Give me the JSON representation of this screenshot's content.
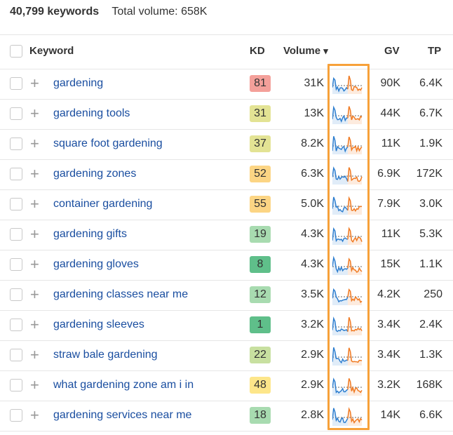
{
  "summary": {
    "count": "40,799 keywords",
    "total_volume": "Total volume: 658K"
  },
  "columns": {
    "keyword": "Keyword",
    "kd": "KD",
    "volume": "Volume",
    "sort_icon": "▾",
    "gv": "GV",
    "tp": "TP"
  },
  "rows": [
    {
      "keyword": "gardening",
      "kd": "81",
      "kd_color": "#f4a09a",
      "volume": "31K",
      "gv": "90K",
      "tp": "6.4K"
    },
    {
      "keyword": "gardening tools",
      "kd": "31",
      "kd_color": "#e3e394",
      "volume": "13K",
      "gv": "44K",
      "tp": "6.7K"
    },
    {
      "keyword": "square foot gardening",
      "kd": "37",
      "kd_color": "#e3e394",
      "volume": "8.2K",
      "gv": "11K",
      "tp": "1.9K"
    },
    {
      "keyword": "gardening zones",
      "kd": "52",
      "kd_color": "#fcd584",
      "volume": "6.3K",
      "gv": "6.9K",
      "tp": "172K"
    },
    {
      "keyword": "container gardening",
      "kd": "55",
      "kd_color": "#fcd584",
      "volume": "5.0K",
      "gv": "7.9K",
      "tp": "3.0K"
    },
    {
      "keyword": "gardening gifts",
      "kd": "19",
      "kd_color": "#a8dbb0",
      "volume": "4.3K",
      "gv": "11K",
      "tp": "5.3K"
    },
    {
      "keyword": "gardening gloves",
      "kd": "8",
      "kd_color": "#5fbf8a",
      "volume": "4.3K",
      "gv": "15K",
      "tp": "1.1K"
    },
    {
      "keyword": "gardening classes near me",
      "kd": "12",
      "kd_color": "#a8dbb0",
      "volume": "3.5K",
      "gv": "4.2K",
      "tp": "250"
    },
    {
      "keyword": "gardening sleeves",
      "kd": "1",
      "kd_color": "#5fbf8a",
      "volume": "3.2K",
      "gv": "3.4K",
      "tp": "2.4K"
    },
    {
      "keyword": "straw bale gardening",
      "kd": "22",
      "kd_color": "#c8e0a0",
      "volume": "2.9K",
      "gv": "3.4K",
      "tp": "1.3K"
    },
    {
      "keyword": "what gardening zone am i in",
      "kd": "48",
      "kd_color": "#fde68a",
      "volume": "2.9K",
      "gv": "3.2K",
      "tp": "168K"
    },
    {
      "keyword": "gardening services near me",
      "kd": "18",
      "kd_color": "#a8dbb0",
      "volume": "2.8K",
      "gv": "14K",
      "tp": "6.6K"
    }
  ],
  "colors": {
    "highlight": "#f7a13a",
    "trend_past": "#2f7fd0",
    "trend_recent": "#f07a22"
  }
}
